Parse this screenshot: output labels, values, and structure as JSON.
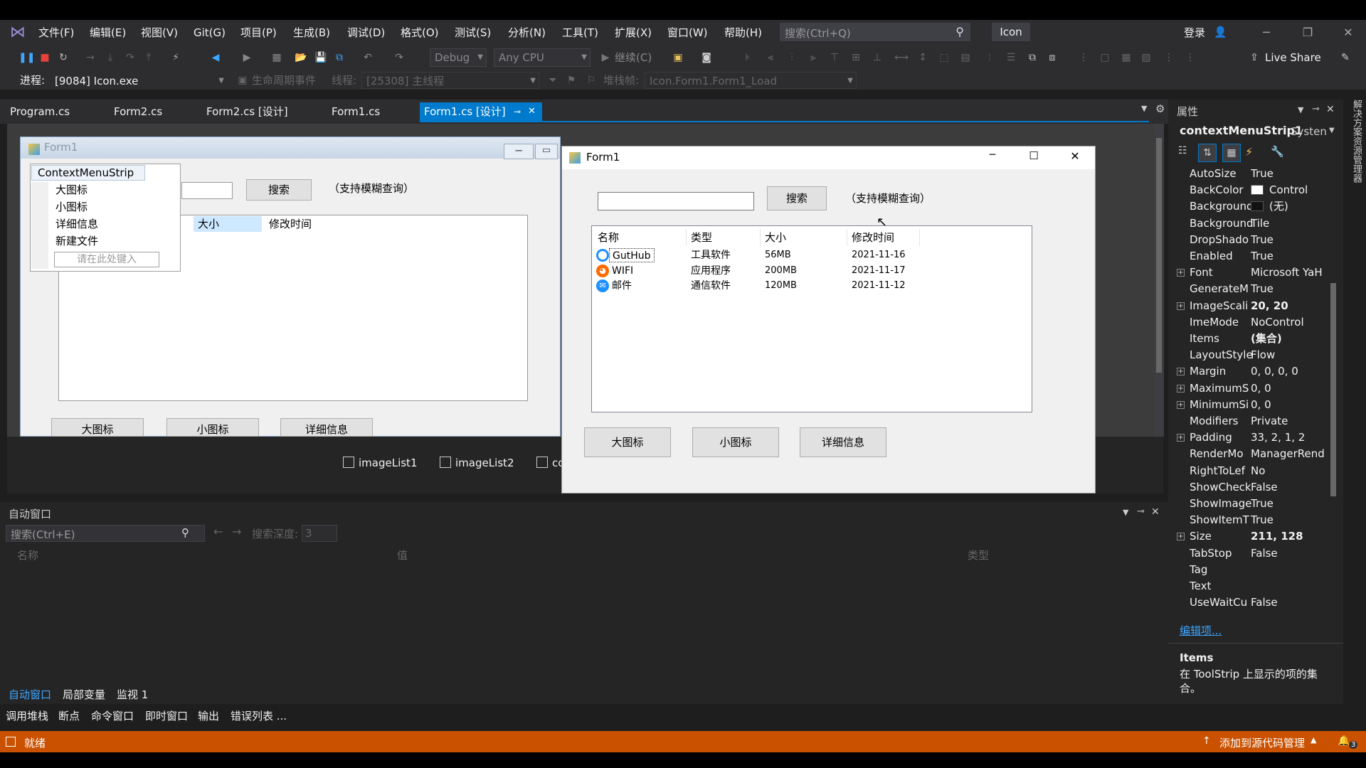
{
  "menu": {
    "items": [
      "文件(F)",
      "编辑(E)",
      "视图(V)",
      "Git(G)",
      "项目(P)",
      "生成(B)",
      "调试(D)",
      "格式(O)",
      "测试(S)",
      "分析(N)",
      "工具(T)",
      "扩展(X)",
      "窗口(W)",
      "帮助(H)"
    ],
    "search_placeholder": "搜索(Ctrl+Q)",
    "solution_name": "Icon",
    "login": "登录"
  },
  "toolbar": {
    "config": "Debug",
    "platform": "Any CPU",
    "continue": "继续(C)",
    "live_share": "Live Share"
  },
  "debugbar": {
    "process_label": "进程:",
    "process": "[9084] Icon.exe",
    "lifecycle": "生命周期事件",
    "thread_label": "线程:",
    "thread": "[25308] 主线程",
    "stack_label": "堆栈帧:",
    "stack": "Icon.Form1.Form1_Load"
  },
  "tabs": [
    {
      "label": "Program.cs"
    },
    {
      "label": "Form2.cs"
    },
    {
      "label": "Form2.cs [设计]"
    },
    {
      "label": "Form1.cs"
    },
    {
      "label": "Form1.cs [设计]"
    }
  ],
  "designer": {
    "form_title": "Form1",
    "context_menu_title": "ContextMenuStrip",
    "context_menu_items": [
      "大图标",
      "小图标",
      "详细信息",
      "新建文件"
    ],
    "context_menu_placeholder": "请在此处键入",
    "search_button": "搜索",
    "hint": "（支持模糊查询）",
    "col_size": "大小",
    "col_modified": "修改时间",
    "buttons": [
      "大图标",
      "小图标",
      "详细信息"
    ],
    "tray": [
      "imageList1",
      "imageList2",
      "co"
    ]
  },
  "running_form": {
    "title": "Form1",
    "search_button": "搜索",
    "hint": "（支持模糊查询）",
    "columns": [
      "名称",
      "类型",
      "大小",
      "修改时间"
    ],
    "rows": [
      {
        "name": "GutHub",
        "type": "工具软件",
        "size": "56MB",
        "date": "2021-11-16",
        "icon_color": "#1e90ff"
      },
      {
        "name": "WIFI",
        "type": "应用程序",
        "size": "200MB",
        "date": "2021-11-17",
        "icon_color": "#ff6a00"
      },
      {
        "name": "邮件",
        "type": "通信软件",
        "size": "120MB",
        "date": "2021-11-12",
        "icon_color": "#1e90ff"
      }
    ],
    "buttons": [
      "大图标",
      "小图标",
      "详细信息"
    ]
  },
  "properties": {
    "header": "属性",
    "object": "contextMenuStrip1",
    "object_type": "Systen",
    "rows": [
      {
        "name": "AutoSize",
        "value": "True",
        "expand": false,
        "bold": false
      },
      {
        "name": "BackColor",
        "value": "Control",
        "expand": false,
        "bold": false,
        "swatch": "#ffffff"
      },
      {
        "name": "Background",
        "value": "(无)",
        "expand": false,
        "bold": false,
        "swatch": "#111111"
      },
      {
        "name": "Background",
        "value": "Tile",
        "expand": false,
        "bold": false
      },
      {
        "name": "DropShado",
        "value": "True",
        "expand": false,
        "bold": false
      },
      {
        "name": "Enabled",
        "value": "True",
        "expand": false,
        "bold": false
      },
      {
        "name": "Font",
        "value": "Microsoft YaH",
        "expand": true,
        "bold": false
      },
      {
        "name": "GenerateM",
        "value": "True",
        "expand": false,
        "bold": false
      },
      {
        "name": "ImageScali",
        "value": "20, 20",
        "expand": true,
        "bold": true
      },
      {
        "name": "ImeMode",
        "value": "NoControl",
        "expand": false,
        "bold": false
      },
      {
        "name": "Items",
        "value": "(集合)",
        "expand": false,
        "bold": true
      },
      {
        "name": "LayoutStyle",
        "value": "Flow",
        "expand": false,
        "bold": false
      },
      {
        "name": "Margin",
        "value": "0, 0, 0, 0",
        "expand": true,
        "bold": false
      },
      {
        "name": "MaximumS",
        "value": "0, 0",
        "expand": true,
        "bold": false
      },
      {
        "name": "MinimumSi",
        "value": "0, 0",
        "expand": true,
        "bold": false
      },
      {
        "name": "Modifiers",
        "value": "Private",
        "expand": false,
        "bold": false
      },
      {
        "name": "Padding",
        "value": "33, 2, 1, 2",
        "expand": true,
        "bold": false
      },
      {
        "name": "RenderMo",
        "value": "ManagerRend",
        "expand": false,
        "bold": false
      },
      {
        "name": "RightToLef",
        "value": "No",
        "expand": false,
        "bold": false
      },
      {
        "name": "ShowCheck",
        "value": "False",
        "expand": false,
        "bold": false
      },
      {
        "name": "ShowImage",
        "value": "True",
        "expand": false,
        "bold": false
      },
      {
        "name": "ShowItemT",
        "value": "True",
        "expand": false,
        "bold": false
      },
      {
        "name": "Size",
        "value": "211, 128",
        "expand": true,
        "bold": true
      },
      {
        "name": "TabStop",
        "value": "False",
        "expand": false,
        "bold": false
      },
      {
        "name": "Tag",
        "value": "",
        "expand": false,
        "bold": false
      },
      {
        "name": "Text",
        "value": "",
        "expand": false,
        "bold": false
      },
      {
        "name": "UseWaitCu",
        "value": "False",
        "expand": false,
        "bold": false
      }
    ],
    "edit_link": "编辑项...",
    "desc_title": "Items",
    "desc_text": "在 ToolStrip 上显示的项的集合。",
    "side_label": "解决方案资源管理器"
  },
  "autowindow": {
    "title": "自动窗口",
    "search_placeholder": "搜索(Ctrl+E)",
    "depth_label": "搜索深度:",
    "depth_value": "3",
    "col_name": "名称",
    "col_value": "值",
    "col_type": "类型",
    "tabs": [
      "自动窗口",
      "局部变量",
      "监视 1"
    ],
    "bottom_tabs": [
      "调用堆栈",
      "断点",
      "命令窗口",
      "即时窗口",
      "输出",
      "错误列表 ..."
    ]
  },
  "status": {
    "text": "就绪",
    "source_control": "添加到源代码管理",
    "notifications": "3"
  }
}
